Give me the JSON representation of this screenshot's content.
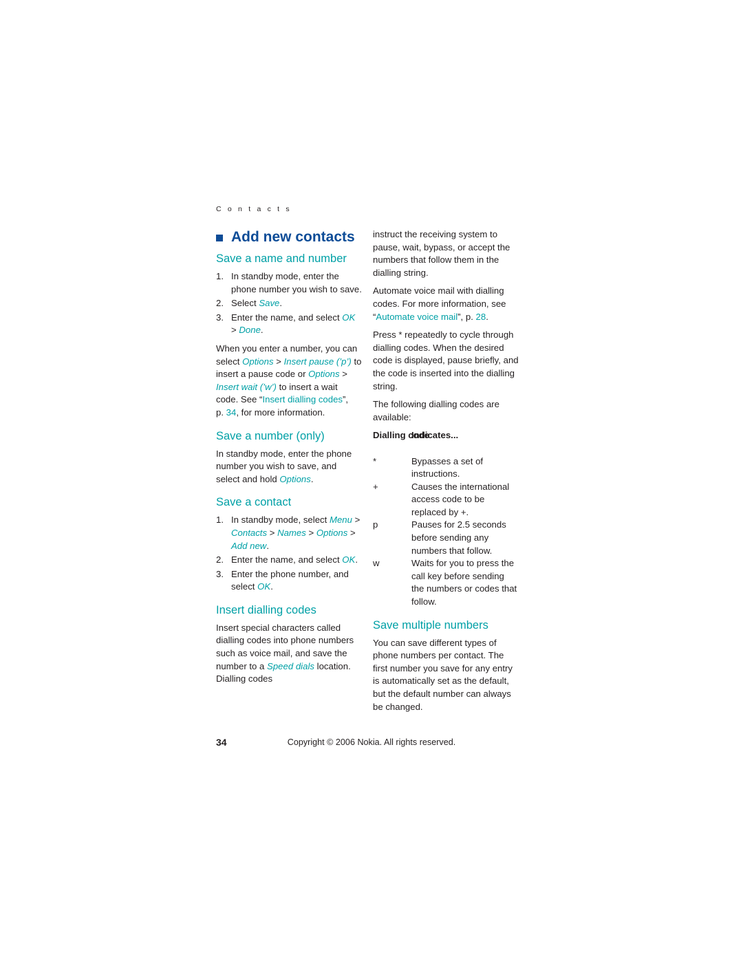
{
  "page": {
    "running_head": "C o n t a c t s",
    "page_number": "34",
    "copyright": "Copyright © 2006 Nokia. All rights reserved."
  },
  "colors": {
    "heading_blue": "#0d4c97",
    "subheading_teal": "#00a0a6",
    "body_text": "#231f20"
  },
  "left_column": {
    "section_title": "Add new contacts",
    "sub1_title": "Save a name and number",
    "sub1_steps": [
      {
        "num": "1.",
        "text_parts": [
          {
            "t": "In standby mode, enter the phone number you wish to save.",
            "style": "plain"
          }
        ]
      },
      {
        "num": "2.",
        "text_parts": [
          {
            "t": "Select ",
            "style": "plain"
          },
          {
            "t": "Save",
            "style": "em"
          },
          {
            "t": ".",
            "style": "plain"
          }
        ]
      },
      {
        "num": "3.",
        "text_parts": [
          {
            "t": "Enter the name, and select ",
            "style": "plain"
          },
          {
            "t": "OK",
            "style": "em"
          },
          {
            "t": " > ",
            "style": "plain"
          },
          {
            "t": "Done",
            "style": "em"
          },
          {
            "t": ".",
            "style": "plain"
          }
        ]
      }
    ],
    "sub1_para_parts": [
      {
        "t": "When you enter a number, you can select ",
        "style": "plain"
      },
      {
        "t": "Options",
        "style": "em"
      },
      {
        "t": " > ",
        "style": "plain"
      },
      {
        "t": "Insert pause (’p’)",
        "style": "em"
      },
      {
        "t": " to insert a pause code or ",
        "style": "plain"
      },
      {
        "t": "Options",
        "style": "em"
      },
      {
        "t": " > ",
        "style": "plain"
      },
      {
        "t": "Insert wait (’w’)",
        "style": "em"
      },
      {
        "t": " to insert a wait code. See “",
        "style": "plain"
      },
      {
        "t": "Insert dialling codes",
        "style": "link"
      },
      {
        "t": "”, p. ",
        "style": "plain"
      },
      {
        "t": "34",
        "style": "link"
      },
      {
        "t": ", for more information.",
        "style": "plain"
      }
    ],
    "sub2_title": "Save a number (only)",
    "sub2_para_parts": [
      {
        "t": "In standby mode, enter the phone number you wish to save, and select and hold ",
        "style": "plain"
      },
      {
        "t": "Options",
        "style": "em"
      },
      {
        "t": ".",
        "style": "plain"
      }
    ],
    "sub3_title": "Save a contact",
    "sub3_steps": [
      {
        "num": "1.",
        "text_parts": [
          {
            "t": "In standby mode, select ",
            "style": "plain"
          },
          {
            "t": "Menu",
            "style": "em"
          },
          {
            "t": " > ",
            "style": "plain"
          },
          {
            "t": "Contacts",
            "style": "em"
          },
          {
            "t": " > ",
            "style": "plain"
          },
          {
            "t": "Names",
            "style": "em"
          },
          {
            "t": " > ",
            "style": "plain"
          },
          {
            "t": "Options",
            "style": "em"
          },
          {
            "t": " > ",
            "style": "plain"
          },
          {
            "t": "Add new",
            "style": "em"
          },
          {
            "t": ".",
            "style": "plain"
          }
        ]
      },
      {
        "num": "2.",
        "text_parts": [
          {
            "t": "Enter the name, and select ",
            "style": "plain"
          },
          {
            "t": "OK",
            "style": "em"
          },
          {
            "t": ".",
            "style": "plain"
          }
        ]
      },
      {
        "num": "3.",
        "text_parts": [
          {
            "t": "Enter the phone number, and select ",
            "style": "plain"
          },
          {
            "t": "OK",
            "style": "em"
          },
          {
            "t": ".",
            "style": "plain"
          }
        ]
      }
    ],
    "sub4_title": "Insert dialling codes",
    "sub4_para_parts": [
      {
        "t": "Insert special characters called dialling codes into phone numbers such as voice mail, and save the number to a ",
        "style": "plain"
      },
      {
        "t": "Speed dials",
        "style": "em"
      },
      {
        "t": " location. Dialling codes",
        "style": "plain"
      }
    ]
  },
  "right_column": {
    "para1": "instruct the receiving system to pause, wait, bypass, or accept the numbers that follow them in the dialling string.",
    "para2_parts": [
      {
        "t": "Automate voice mail with dialling codes. For more information, see “",
        "style": "plain"
      },
      {
        "t": "Automate voice mail",
        "style": "link"
      },
      {
        "t": "”, p. ",
        "style": "plain"
      },
      {
        "t": "28",
        "style": "link"
      },
      {
        "t": ".",
        "style": "plain"
      }
    ],
    "para3": "Press * repeatedly to cycle through dialling codes. When the desired code is displayed, pause briefly, and the code is inserted into the dialling string.",
    "para4": "The following dialling codes are available:",
    "table": {
      "header_col1": "Dialling code",
      "header_col2": "Indicates...",
      "rows": [
        {
          "code": "*",
          "meaning": "Bypasses a set of instructions."
        },
        {
          "code": "+",
          "meaning": "Causes the international access code to be replaced by +."
        },
        {
          "code": "p",
          "meaning": "Pauses for 2.5 seconds before sending any numbers that follow."
        },
        {
          "code": "w",
          "meaning": "Waits for you to press the call key before sending the numbers or codes that follow."
        }
      ]
    },
    "sub_title": "Save multiple numbers",
    "para5": "You can save different types of phone numbers per contact. The first number you save for any entry is automatically set as the default, but the default number can always be changed."
  }
}
